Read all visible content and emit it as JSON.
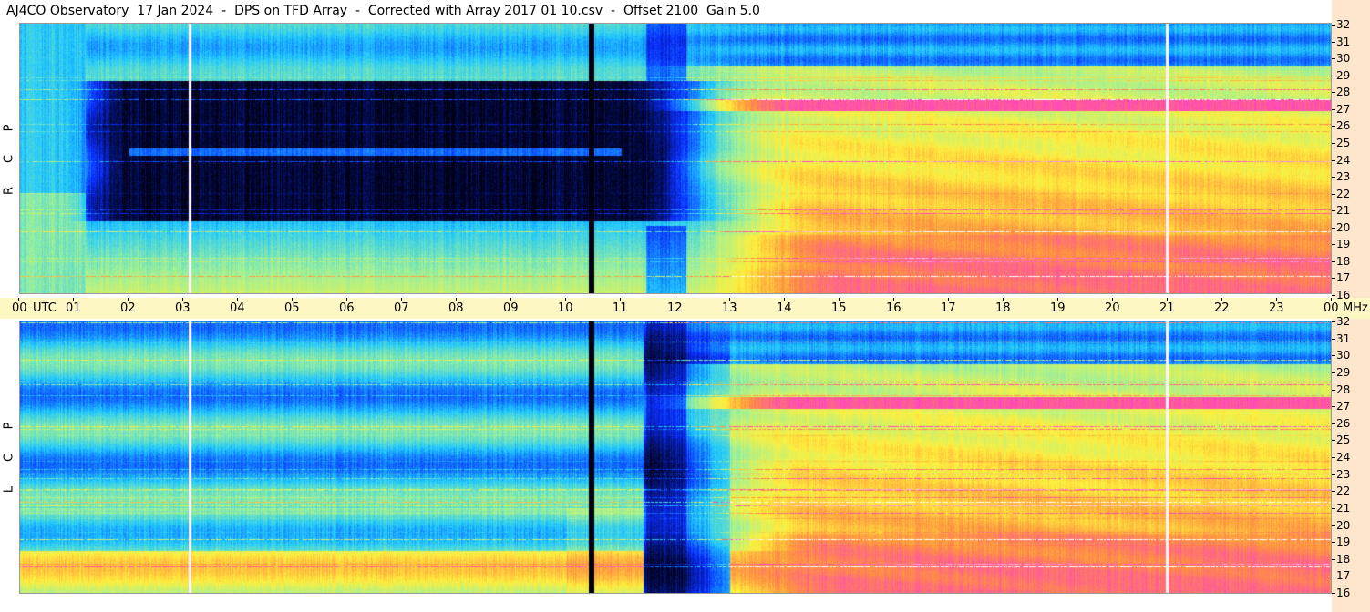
{
  "title": "AJ4CO Observatory  17 Jan 2024  -  DPS on TFD Array  -  Corrected with Array 2017 01 10.csv  -  Offset 2100  Gain 5.0",
  "chart_data": {
    "type": "heatmap",
    "title": "AJ4CO Observatory  17 Jan 2024  -  DPS on TFD Array  -  Corrected with Array 2017 01 10.csv  -  Offset 2100  Gain 5.0",
    "x_axis": {
      "label": "UTC",
      "range_hours": [
        0,
        24
      ],
      "tick_labels": [
        "00",
        "01",
        "02",
        "03",
        "04",
        "05",
        "06",
        "07",
        "08",
        "09",
        "10",
        "11",
        "12",
        "13",
        "14",
        "15",
        "16",
        "17",
        "18",
        "19",
        "20",
        "21",
        "22",
        "23",
        "00"
      ]
    },
    "y_axis": {
      "unit": "MHz",
      "range": [
        16,
        32
      ],
      "tick_labels": [
        "32",
        "31",
        "30",
        "29",
        "28",
        "27",
        "26",
        "25",
        "24",
        "23",
        "22",
        "21",
        "20",
        "19",
        "18",
        "17",
        "16"
      ]
    },
    "panels": [
      {
        "name": "RCP",
        "letters": [
          "R",
          "C",
          "P"
        ]
      },
      {
        "name": "LCP",
        "letters": [
          "L",
          "C",
          "P"
        ]
      }
    ],
    "colormap": [
      "#000010",
      "#0a2eff",
      "#1ec8ff",
      "#9cf09a",
      "#fff03c",
      "#ff9040",
      "#ff40c8",
      "#ffffff"
    ]
  }
}
